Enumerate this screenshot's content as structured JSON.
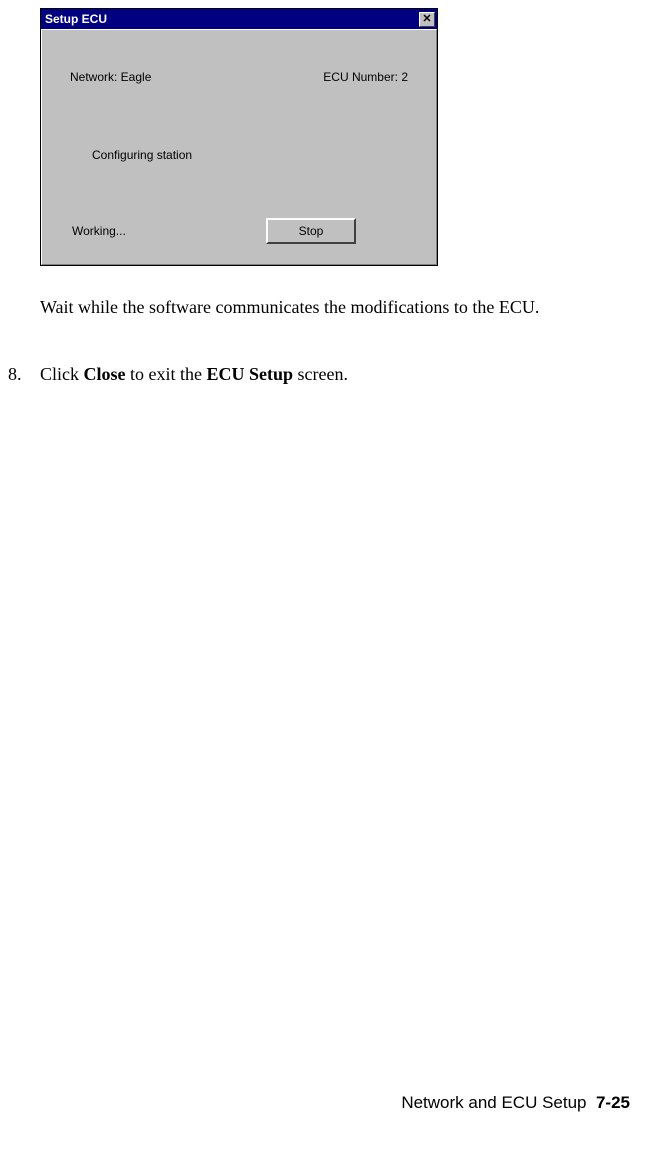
{
  "dialog": {
    "title": "Setup ECU",
    "close_glyph": "✕",
    "network_label": "Network: Eagle",
    "ecu_number_label": "ECU Number: 2",
    "configuring_text": "Configuring station",
    "working_text": "Working...",
    "stop_label": "Stop"
  },
  "body": {
    "wait_text": "Wait while the software communicates the modifications to the ECU.",
    "step_number": "8.",
    "step_prefix": "Click ",
    "step_bold1": "Close",
    "step_mid": " to exit the ",
    "step_bold2": "ECU Setup",
    "step_suffix": " screen."
  },
  "footer": {
    "section": "Network and ECU Setup",
    "page": "7-25"
  }
}
